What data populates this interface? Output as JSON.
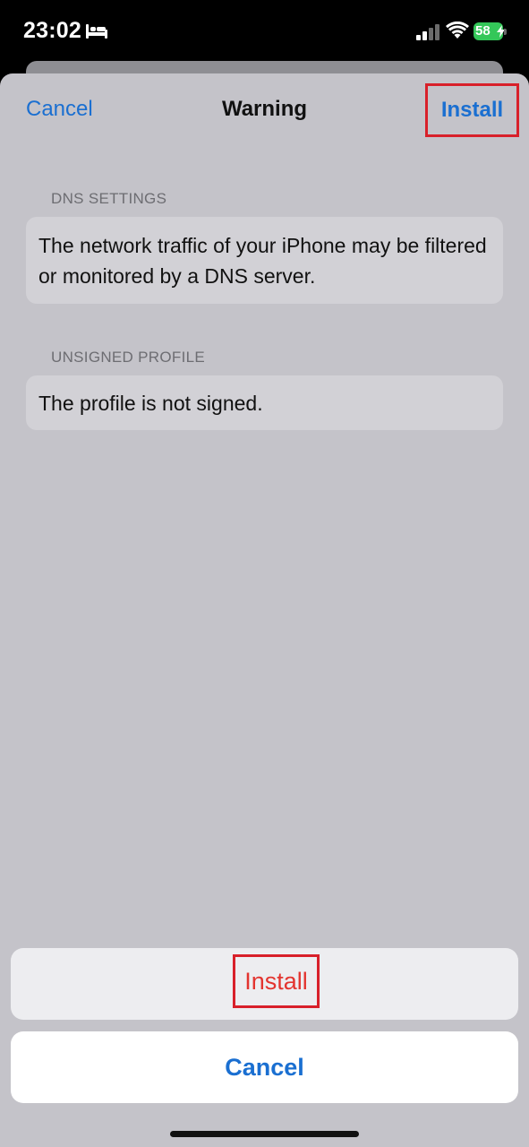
{
  "status_bar": {
    "time": "23:02",
    "battery_level": "58",
    "icons": [
      "bed-icon",
      "cellular-signal-icon",
      "wifi-icon",
      "battery-charging-icon"
    ],
    "battery_color": "#34c759"
  },
  "nav": {
    "cancel_label": "Cancel",
    "title": "Warning",
    "install_label": "Install"
  },
  "sections": {
    "dns": {
      "header": "DNS SETTINGS",
      "text": "The network traffic of your iPhone may be filtered or monitored by a DNS server."
    },
    "unsigned": {
      "header": "UNSIGNED PROFILE",
      "text": "The profile is not signed."
    }
  },
  "action_sheet": {
    "install_label": "Install",
    "cancel_label": "Cancel"
  },
  "colors": {
    "accent_blue": "#1a6fd1",
    "destructive_red": "#e3342f",
    "highlight_box": "#d8202a",
    "sheet_bg": "#c4c3c9"
  }
}
